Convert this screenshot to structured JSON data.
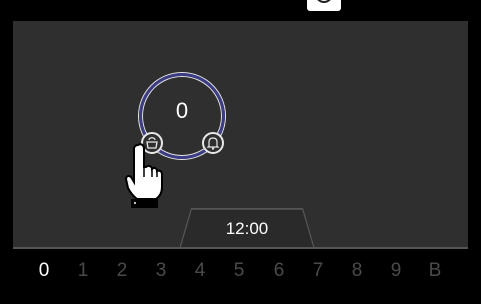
{
  "dial": {
    "value": "0"
  },
  "schedule": {
    "time": "12:00"
  },
  "digits": {
    "items": [
      "0",
      "1",
      "2",
      "3",
      "4",
      "5",
      "6",
      "7",
      "8",
      "9",
      "B"
    ],
    "selected": "0"
  },
  "icons": {
    "left_button": "pot-icon",
    "right_button": "bell-icon",
    "top_right": "circle-icon",
    "pointer": "pointing-hand-icon"
  },
  "colors": {
    "screen_bg": "#2f2f2f",
    "ring_accent": "#3d3d86",
    "active_digit": "#ffffff",
    "inactive_digit": "#4a4a4a"
  }
}
